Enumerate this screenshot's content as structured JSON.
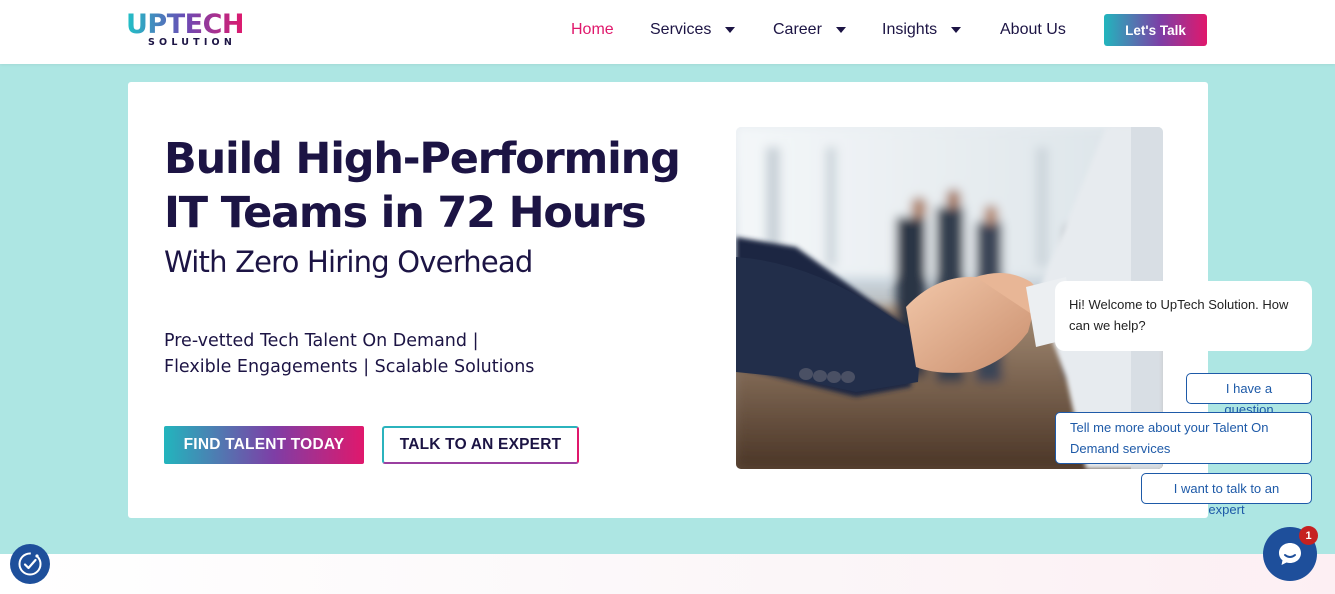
{
  "brand": {
    "logo_main": "UPTECH",
    "logo_sub": "SOLUTION",
    "gradient_start": "#20c3c7",
    "gradient_end": "#e0186c"
  },
  "nav": {
    "items": [
      {
        "label": "Home",
        "active": true,
        "dropdown": false
      },
      {
        "label": "Services",
        "active": false,
        "dropdown": true
      },
      {
        "label": "Career",
        "active": false,
        "dropdown": true
      },
      {
        "label": "Insights",
        "active": false,
        "dropdown": true
      },
      {
        "label": "About Us",
        "active": false,
        "dropdown": false
      }
    ],
    "cta_label": "Let's Talk"
  },
  "hero": {
    "title_line1": "Build High-Performing",
    "title_line2": "IT Teams in 72 Hours",
    "subtitle": "With Zero Hiring Overhead",
    "desc_line1": "Pre-vetted Tech Talent On Demand |",
    "desc_line2": "Flexible Engagements | Scalable Solutions",
    "primary_button": "FIND TALENT TODAY",
    "secondary_button": "TALK TO AN EXPERT",
    "image_subject": "business handshake in office"
  },
  "chat": {
    "welcome": "Hi! Welcome to UpTech Solution. How can we help?",
    "options": [
      "I have a question",
      "Tell me more about your Talent On Demand services",
      "I want to talk to an expert"
    ],
    "badge_count": "1",
    "launcher_icon": "chat-bubble-icon"
  },
  "accessibility": {
    "icon": "accessibility-check-icon"
  },
  "colors": {
    "page_background": "#ade6e3",
    "text_dark": "#1c1444",
    "accent_pink": "#e0186c",
    "accent_teal": "#22b5bd",
    "chat_blue": "#1e5aa8"
  }
}
